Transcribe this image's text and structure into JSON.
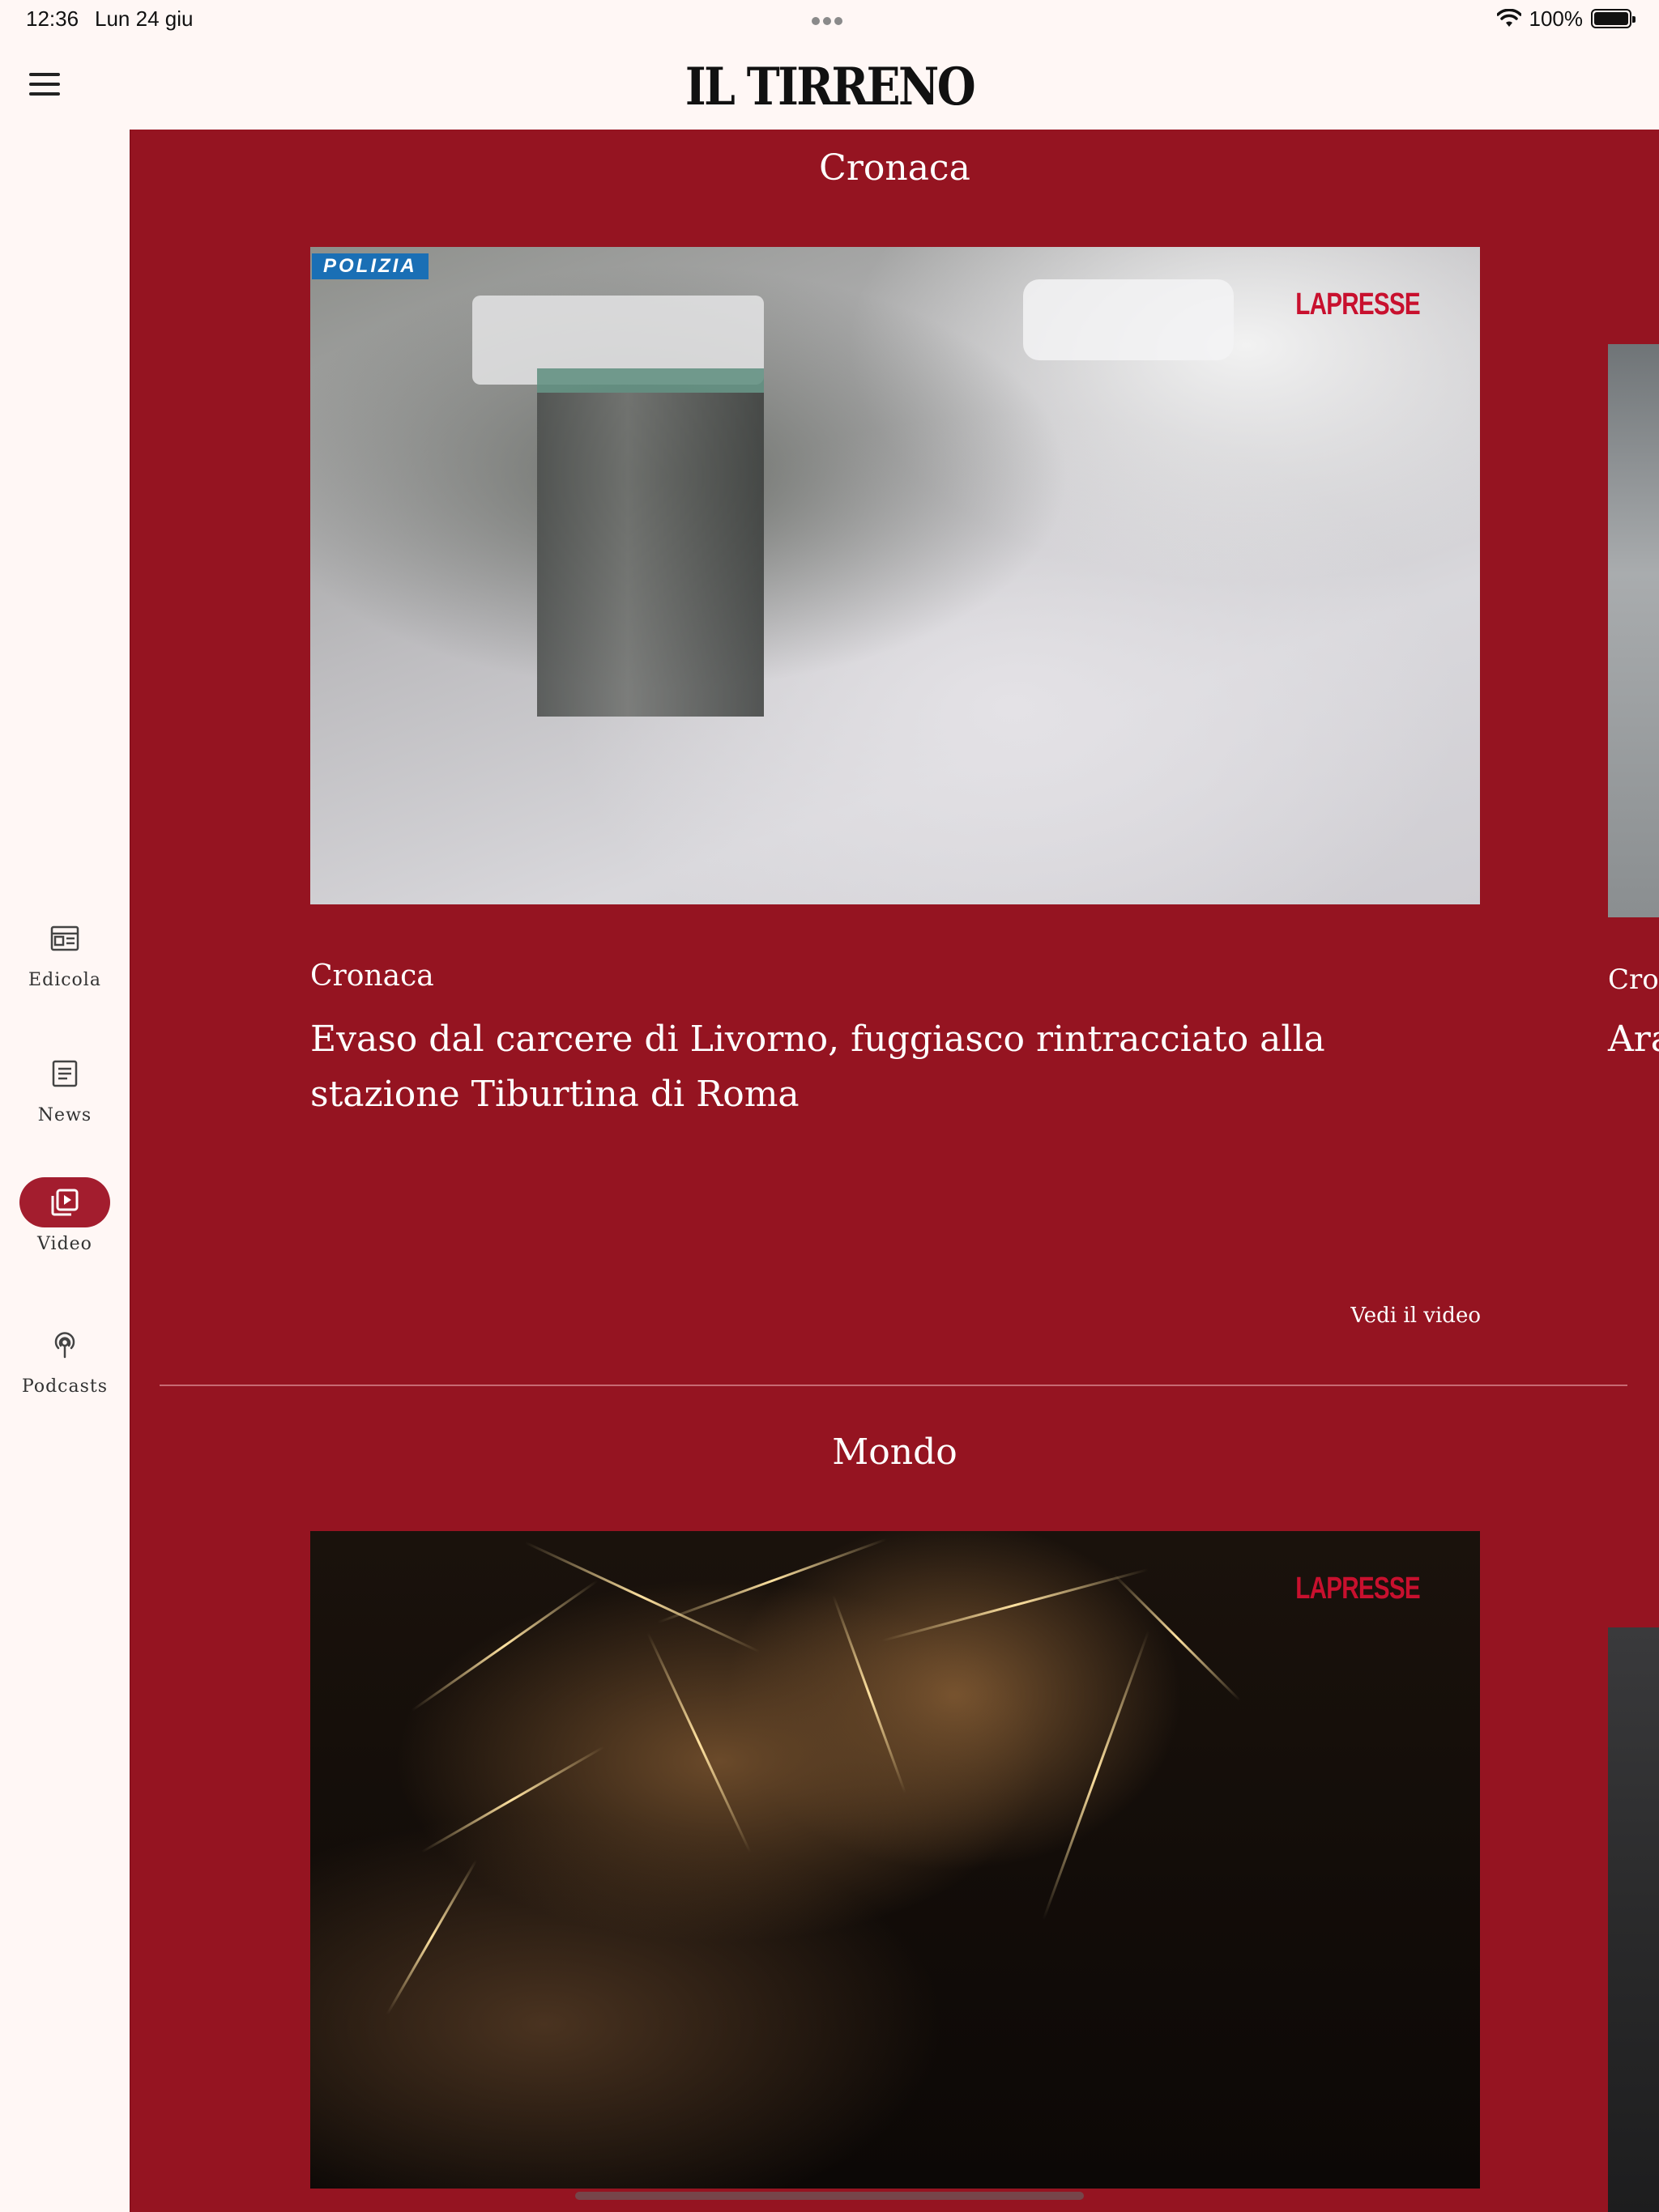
{
  "status_bar": {
    "time": "12:36",
    "date": "Lun 24 giu",
    "battery": "100%",
    "wifi_icon": "wifi-icon",
    "battery_icon": "battery-icon"
  },
  "header": {
    "logo": "IL TIRRENO",
    "menu_icon": "hamburger-menu-icon"
  },
  "nav": {
    "items": [
      {
        "label": "Edicola",
        "icon": "newspaper-icon",
        "active": false
      },
      {
        "label": "News",
        "icon": "article-icon",
        "active": false
      },
      {
        "label": "Video",
        "icon": "video-library-icon",
        "active": true
      },
      {
        "label": "Podcasts",
        "icon": "podcast-icon",
        "active": false
      }
    ]
  },
  "colors": {
    "accent": "#951421",
    "nav_active": "#a31d2e",
    "background": "#fff7f5"
  },
  "sections": [
    {
      "title": "Cronaca",
      "video": {
        "watermark": "LAPRESSE",
        "badge": "POLIZIA"
      },
      "category": "Cronaca",
      "headline": "Evaso dal carcere di Livorno, fuggiasco rintracciato alla stazione Tiburtina di Roma",
      "link": "Vedi il video",
      "peek": {
        "category": "Cron",
        "title": "Ara"
      }
    },
    {
      "title": "Mondo",
      "video": {
        "watermark": "LAPRESSE"
      }
    }
  ]
}
